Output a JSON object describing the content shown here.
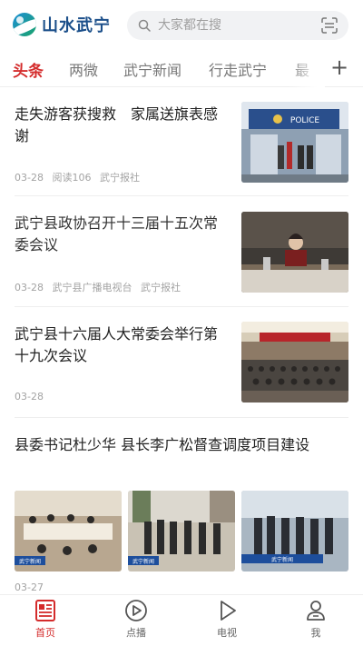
{
  "header": {
    "app_name": "山水武宁",
    "search_placeholder": "大家都在搜"
  },
  "tabs": [
    {
      "label": "头条",
      "active": true
    },
    {
      "label": "两微"
    },
    {
      "label": "武宁新闻"
    },
    {
      "label": "行走武宁"
    },
    {
      "label": "最"
    }
  ],
  "articles": [
    {
      "title": "走失游客获搜救　家属送旗表感谢",
      "date": "03-28",
      "reads": "阅读106",
      "source": "武宁报社",
      "thumbnail": "police-station-photo"
    },
    {
      "title": "武宁县政协召开十三届十五次常委会议",
      "date": "03-28",
      "source": "武宁县广播电视台",
      "source2": "武宁报社",
      "thumbnail": "conference-speaker-photo"
    },
    {
      "title": "武宁县十六届人大常委会举行第十九次会议",
      "date": "03-28",
      "thumbnail": "meeting-hall-photo"
    },
    {
      "title": "县委书记杜少华 县长李广松督查调度项目建设",
      "date": "03-27",
      "thumbnails": [
        "meeting-table-photo",
        "officials-walking-photo",
        "site-inspection-photo"
      ]
    }
  ],
  "tabbar": {
    "items": [
      {
        "label": "首页",
        "icon": "home-news-icon",
        "active": true
      },
      {
        "label": "点播",
        "icon": "play-circle-icon"
      },
      {
        "label": "电视",
        "icon": "play-triangle-icon"
      },
      {
        "label": "我",
        "icon": "user-icon"
      }
    ]
  },
  "colors": {
    "accent": "#d42c2c",
    "brand": "#1b4f8a",
    "meta": "#a3a3a3"
  }
}
